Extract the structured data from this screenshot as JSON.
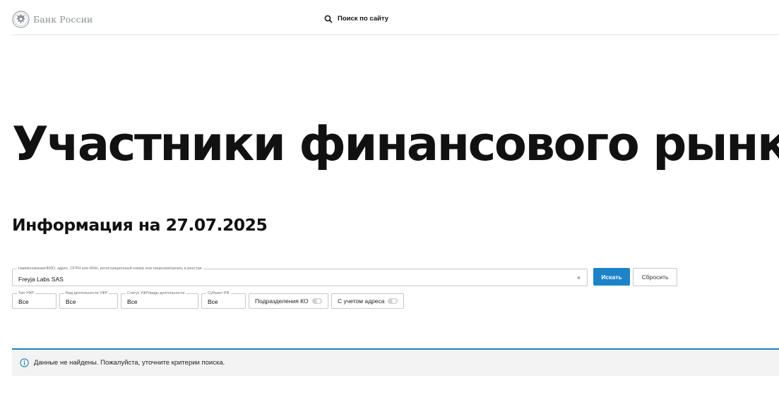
{
  "header": {
    "logo_text": "Банк России",
    "search_label": "Поиск по сайту"
  },
  "page": {
    "title": "Участники финансового рынка",
    "info_date": "Информация на 27.07.2025"
  },
  "search": {
    "legend": "Наименование/ФИО, адрес, ОГРН или ИНН, регистрационный номер или лицензия/запись в реестре",
    "value": "Freyja Labs SAS",
    "clear_symbol": "×",
    "search_button": "Искать",
    "reset_button": "Сбросить"
  },
  "filters": {
    "type": {
      "legend": "Тип УФР",
      "value": "Все"
    },
    "activity": {
      "legend": "Вид деятельности УФР",
      "value": "Все"
    },
    "status": {
      "legend": "Статус УФР/виды деятельности",
      "value": "Все"
    },
    "region": {
      "legend": "Субъект РФ",
      "value": "Все"
    }
  },
  "toggles": {
    "branches": {
      "label": "Подразделения КО",
      "on": false
    },
    "address": {
      "label": "С учетом адреса",
      "on": false
    }
  },
  "notice": {
    "text": "Данные не найдены. Пожалуйста, уточните критерии поиска."
  },
  "colors": {
    "accent": "#1d83c8",
    "notice_border": "#1c82b8",
    "notice_bg": "#f3f3f3",
    "logo_gray": "#8a8f95"
  },
  "icons": {
    "logo": "bank-of-russia-emblem-icon",
    "search": "search-icon",
    "info": "info-icon"
  }
}
